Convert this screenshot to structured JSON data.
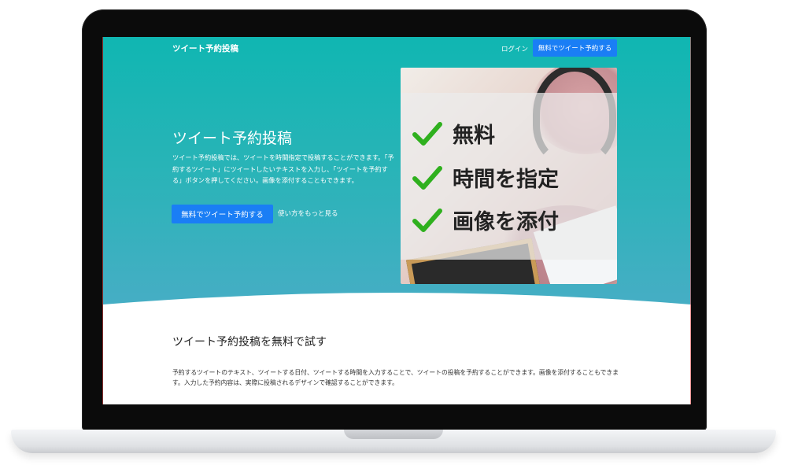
{
  "header": {
    "brand": "ツイート予約投稿",
    "login_label": "ログイン",
    "cta_label": "無料でツイート予約する"
  },
  "hero": {
    "title": "ツイート予約投稿",
    "description": "ツイート予約投稿では、ツイートを時間指定で投稿することができます。「予約するツイート」にツイートしたいテキストを入力し、「ツイートを予約する」ボタンを押してください。画像を添付することもできます。",
    "cta_label": "無料でツイート予約する",
    "more_link": "使い方をもっと見る"
  },
  "promo": {
    "features": [
      "無料",
      "時間を指定",
      "画像を添付"
    ],
    "check_color": "#2fb01e"
  },
  "section": {
    "title": "ツイート予約投稿を無料で試す",
    "body": "予約するツイートのテキスト、ツイートする日付、ツイートする時間を入力することで、ツイートの投稿を予約することができます。画像を添付することもできます。入力した予約内容は、実際に投稿されるデザインで確認することができます。"
  },
  "colors": {
    "hero_top": "#10b6b2",
    "hero_bottom": "#49adc6",
    "button": "#1a7ef5"
  }
}
